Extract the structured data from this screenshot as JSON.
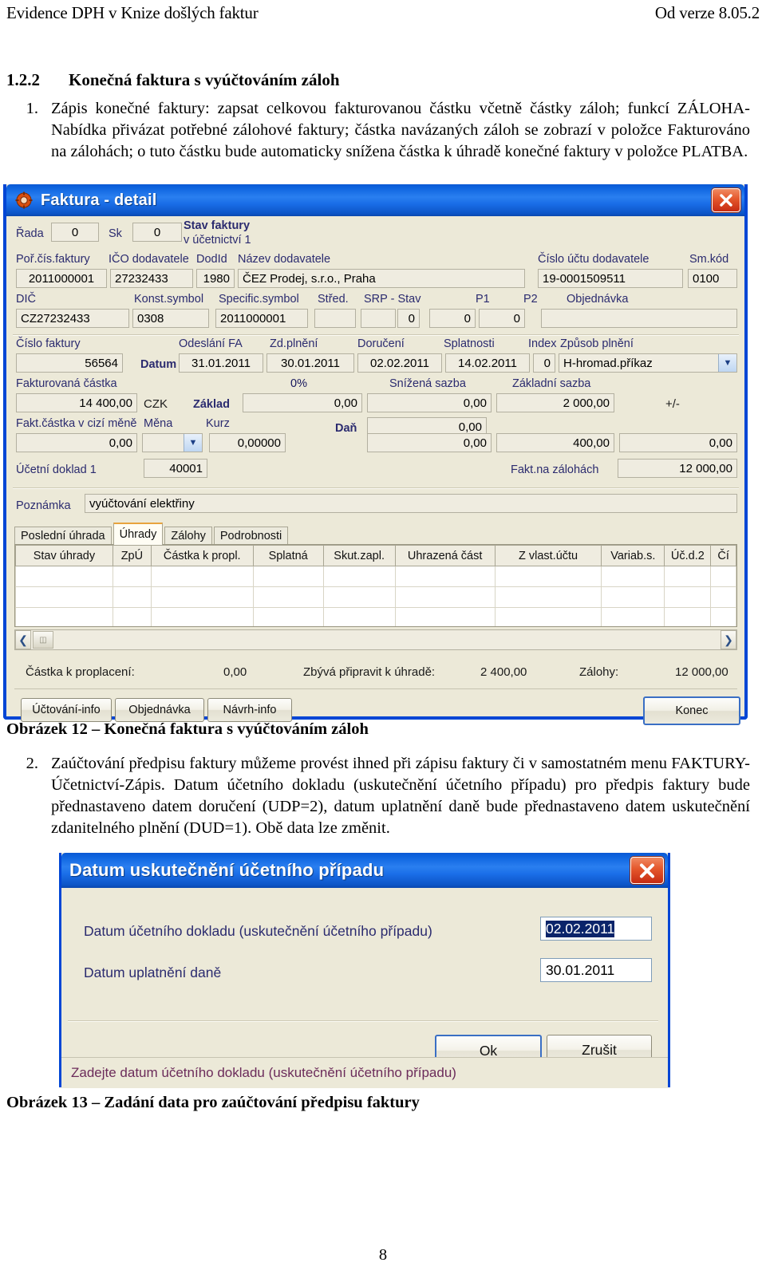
{
  "header": {
    "left": "Evidence DPH v Knize došlých faktur",
    "right": "Od verze 8.05.2"
  },
  "section": {
    "number": "1.2.2",
    "title": "Konečná faktura s vyúčtováním záloh"
  },
  "paragraphs": [
    {
      "marker": "1.",
      "text": "Zápis konečné faktury: zapsat celkovou fakturovanou částku včetně částky záloh; funkcí ZÁLOHA-Nabídka přivázat potřebné zálohové faktury; částka navázaných záloh se zobrazí v položce Fakturováno na zálohách; o tuto částku bude automaticky snížena částka k úhradě konečné faktury v položce PLATBA."
    },
    {
      "marker": "2.",
      "text": "Zaúčtování předpisu faktury můžeme provést ihned při zápisu faktury či v samostatném menu FAKTURY-Účetnictví-Zápis. Datum účetního dokladu (uskutečnění účetního případu) pro předpis faktury bude přednastaveno datem doručení (UDP=2), datum uplatnění daně bude přednastaveno datem uskutečnění zdanitelného plnění (DUD=1). Obě data lze změnit."
    }
  ],
  "captions": {
    "fig12": "Obrázek 12 – Konečná faktura s vyúčtováním záloh",
    "fig13": "Obrázek 13 – Zadání data pro zaúčtování předpisu faktury"
  },
  "page_number": "8",
  "invoice_dialog": {
    "title": "Faktura - detail",
    "title_icon": "gear-icon",
    "close_icon": "close-icon",
    "row1": {
      "rada_label": "Řada",
      "rada_value": "0",
      "sk_label": "Sk",
      "sk_value": "0",
      "stav_label_1": "Stav faktury",
      "stav_label_2": "v účetnictví 1"
    },
    "row2": {
      "por_cis_label": "Poř.čís.faktury",
      "por_cis_value": "2011000001",
      "ico_label": "IČO dodavatele",
      "ico_value": "27232433",
      "dodid_label": "DodId",
      "dodid_value": "1980",
      "nazev_label": "Název dodavatele",
      "nazev_value": "ČEZ Prodej, s.r.o., Praha",
      "ucet_label": "Číslo účtu  dodavatele",
      "ucet_value": "19-0001509511",
      "smkod_label": "Sm.kód",
      "smkod_value": "0100"
    },
    "row3": {
      "dic_label": "DIČ",
      "dic_value": "CZ27232433",
      "konst_label": "Konst.symbol",
      "konst_value": "0308",
      "spec_label": "Specific.symbol",
      "spec_value": "2011000001",
      "stred_label": "Střed.",
      "stred_value": "",
      "srp_label": "SRP -  Stav",
      "srp_value": "",
      "stav_value": "0",
      "p1_label": "P1",
      "p1_value": "0",
      "p2_label": "P2",
      "p2_value": "0",
      "objednavka_label": "Objednávka",
      "objednavka_value": ""
    },
    "row4": {
      "cislo_faktury_label": "Číslo faktury",
      "cislo_faktury_value": "56564",
      "datum_label": "Datum",
      "odeslani_label": "Odeslání FA",
      "odeslani_value": "31.01.2011",
      "zdplneni_label": "Zd.plnění",
      "zdplneni_value": "30.01.2011",
      "doruceni_label": "Doručení",
      "doruceni_value": "02.02.2011",
      "splatnosti_label": "Splatnosti",
      "splatnosti_value": "14.02.2011",
      "index_label": "Index",
      "index_value": "0",
      "zpusob_label": "Způsob plnění",
      "zpusob_value": "H-hromad.příkaz"
    },
    "row5": {
      "fakturovana_label": "Fakturovaná částka",
      "fakturovana_value": "14 400,00",
      "mena_code": "CZK",
      "zaklad_label": "Základ",
      "nula_pct_label": "0%",
      "zaklad_0_value": "0,00",
      "snizena_label": "Snížená sazba",
      "snizena_zaklad_value": "0,00",
      "zakladni_label": "Základní sazba",
      "zakladni_zaklad_value": "2 000,00",
      "plusminus_label": "+/-"
    },
    "row6": {
      "cizi_mena_label": "Fakt.částka v cizí měně",
      "cizi_mena_value": "0,00",
      "mena_label": "Měna",
      "mena_value": "",
      "kurz_label": "Kurz",
      "kurz_value": "0,00000",
      "dan_label": "Daň",
      "dan_0_value": "0,00",
      "dan_snizena_value": "0,00",
      "dan_zakladni_value": "400,00",
      "dan_plusminus_value": "0,00"
    },
    "row7": {
      "ucetni_doklad_label": "Účetní doklad 1",
      "ucetni_doklad_value": "40001",
      "zalohy_label": "Fakt.na zálohách",
      "zalohy_value": "12 000,00"
    },
    "poznamka": {
      "label": "Poznámka",
      "value": "vyúčtování elektřiny"
    },
    "tabs": [
      {
        "label": "Poslední úhrada",
        "active": false
      },
      {
        "label": "Úhrady",
        "active": true
      },
      {
        "label": "Zálohy",
        "active": false
      },
      {
        "label": "Podrobnosti",
        "active": false
      }
    ],
    "grid": {
      "columns": [
        "Stav  úhrady",
        "ZpÚ",
        "Částka k propl.",
        "Splatná",
        "Skut.zapl.",
        "Uhrazená část",
        "Z vlast.účtu",
        "Variab.s.",
        "Úč.d.2",
        "Čí"
      ],
      "rows": [
        [
          "",
          "",
          "",
          "",
          "",
          "",
          "",
          "",
          "",
          ""
        ],
        [
          "",
          "",
          "",
          "",
          "",
          "",
          "",
          "",
          "",
          ""
        ],
        [
          "",
          "",
          "",
          "",
          "",
          "",
          "",
          "",
          "",
          ""
        ]
      ]
    },
    "scrollbar": {
      "left_arrow": "chevron-left-icon",
      "right_arrow": "chevron-right-icon"
    },
    "summary": {
      "castka_label": "Částka k proplacení:",
      "castka_value": "0,00",
      "zbyva_label": "Zbývá připravit k úhradě:",
      "zbyva_value": "2 400,00",
      "zalohy_label": "Zálohy:",
      "zalohy_value": "12 000,00"
    },
    "buttons": {
      "uctovani_info": "Účtování-info",
      "objednavka": "Objednávka",
      "navrh_info": "Návrh-info",
      "konec": "Konec"
    }
  },
  "date_dialog": {
    "title": "Datum uskutečnění účetního případu",
    "close_icon": "close-icon",
    "field1_label": "Datum účetního dokladu (uskutečnění účetního případu)",
    "field1_value": "02.02.2011",
    "field2_label": "Datum uplatnění daně",
    "field2_value": "30.01.2011",
    "ok_label": "Ok",
    "cancel_label": "Zrušit",
    "status": "Zadejte datum účetního dokladu (uskutečnění účetního případu)"
  }
}
